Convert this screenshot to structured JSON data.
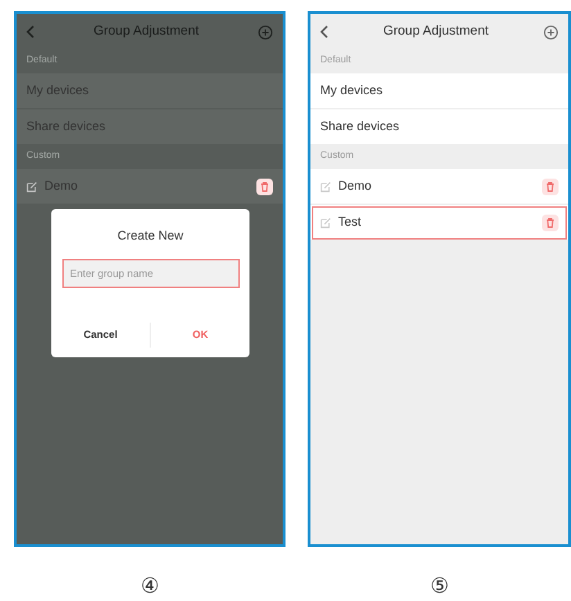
{
  "screens": [
    {
      "header": {
        "title": "Group Adjustment"
      },
      "sections": [
        {
          "label": "Default",
          "items": [
            {
              "label": "My devices",
              "kind": "plain",
              "highlighted": false
            },
            {
              "label": "Share devices",
              "kind": "plain",
              "highlighted": false
            }
          ]
        },
        {
          "label": "Custom",
          "items": [
            {
              "label": "Demo",
              "kind": "group",
              "highlighted": false
            }
          ]
        }
      ],
      "dialog": {
        "title": "Create New",
        "placeholder": "Enter group name",
        "field_highlighted": true,
        "buttons": [
          {
            "label": "Cancel",
            "kind": "cancel"
          },
          {
            "label": "OK",
            "kind": "confirm"
          }
        ]
      },
      "caption": "④"
    },
    {
      "header": {
        "title": "Group Adjustment"
      },
      "sections": [
        {
          "label": "Default",
          "items": [
            {
              "label": "My devices",
              "kind": "plain",
              "highlighted": false
            },
            {
              "label": "Share devices",
              "kind": "plain",
              "highlighted": false
            }
          ]
        },
        {
          "label": "Custom",
          "items": [
            {
              "label": "Demo",
              "kind": "group",
              "highlighted": false
            },
            {
              "label": "Test",
              "kind": "group",
              "highlighted": true
            }
          ]
        }
      ],
      "caption": "⑤"
    }
  ]
}
